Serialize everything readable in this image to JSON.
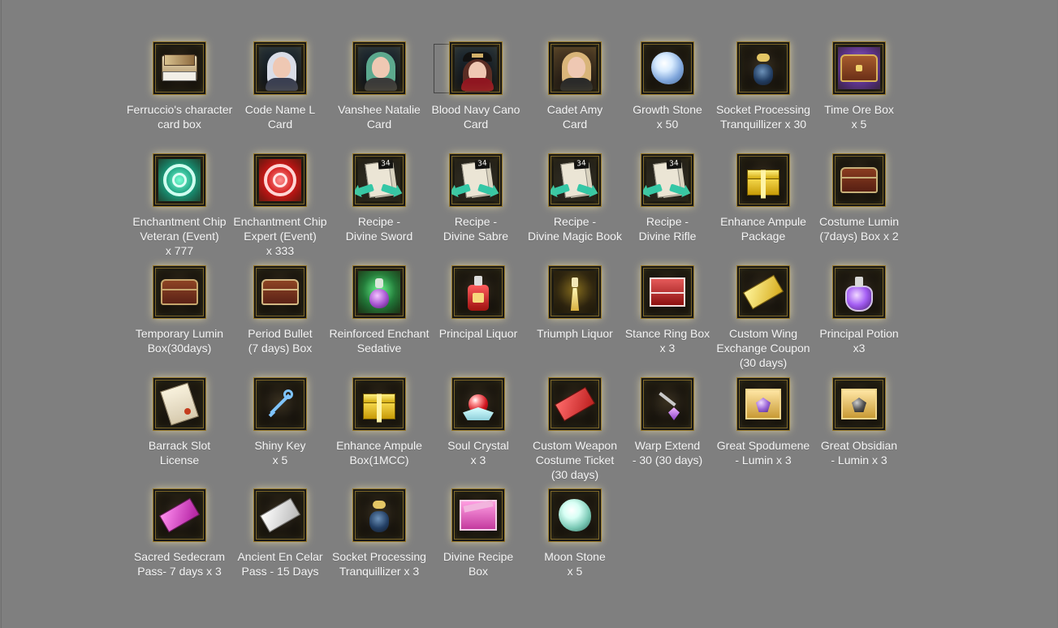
{
  "reward_grid": {
    "items": [
      {
        "label": "Ferruccio's character\ncard box"
      },
      {
        "label": "Code Name L\nCard"
      },
      {
        "label": "Vanshee Natalie\nCard"
      },
      {
        "label": "Blood Navy Cano\nCard"
      },
      {
        "label": "Cadet Amy\nCard"
      },
      {
        "label": "Growth Stone\nx 50"
      },
      {
        "label": "Socket Processing\nTranquillizer x 30"
      },
      {
        "label": "Time Ore Box\nx 5"
      },
      {
        "label": "Enchantment Chip\nVeteran (Event)\nx 777"
      },
      {
        "label": "Enchantment Chip\nExpert (Event)\nx 333"
      },
      {
        "label": "Recipe -\nDivine Sword"
      },
      {
        "label": "Recipe -\nDivine Sabre"
      },
      {
        "label": "Recipe -\nDivine Magic Book"
      },
      {
        "label": "Recipe -\nDivine Rifle"
      },
      {
        "label": "Enhance Ampule\nPackage"
      },
      {
        "label": "Costume Lumin\n(7days) Box x 2"
      },
      {
        "label": "Temporary Lumin\nBox(30days)"
      },
      {
        "label": "Period Bullet\n(7 days) Box"
      },
      {
        "label": "Reinforced Enchant\nSedative"
      },
      {
        "label": "Principal Liquor"
      },
      {
        "label": "Triumph Liquor"
      },
      {
        "label": "Stance Ring Box\nx 3"
      },
      {
        "label": "Custom Wing\nExchange Coupon\n(30 days)"
      },
      {
        "label": "Principal Potion\nx3"
      },
      {
        "label": "Barrack Slot\nLicense"
      },
      {
        "label": "Shiny Key\nx 5"
      },
      {
        "label": "Enhance Ampule\nBox(1MCC)"
      },
      {
        "label": "Soul Crystal\nx 3"
      },
      {
        "label": "Custom Weapon\nCostume Ticket\n(30 days)"
      },
      {
        "label": "Warp Extend\n- 30 (30 days)"
      },
      {
        "label": "Great Spodumene\n- Lumin x 3"
      },
      {
        "label": "Great Obsidian\n- Lumin x 3"
      },
      {
        "label": "Sacred Sedecram\nPass- 7 days x 3"
      },
      {
        "label": "Ancient En Celar\nPass - 15 Days"
      },
      {
        "label": "Socket Processing\nTranquillizer x 3"
      },
      {
        "label": "Divine Recipe\nBox"
      },
      {
        "label": "Moon Stone\nx 5"
      }
    ],
    "recipe_badge": "34"
  }
}
